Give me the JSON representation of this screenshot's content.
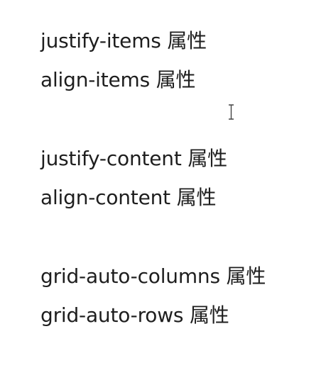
{
  "lines": [
    "justify-items 属性",
    "align-items 属性",
    "justify-content 属性",
    "align-content 属性",
    "grid-auto-columns 属性",
    "grid-auto-rows 属性"
  ],
  "cursor": {
    "icon": "text-cursor-icon"
  }
}
